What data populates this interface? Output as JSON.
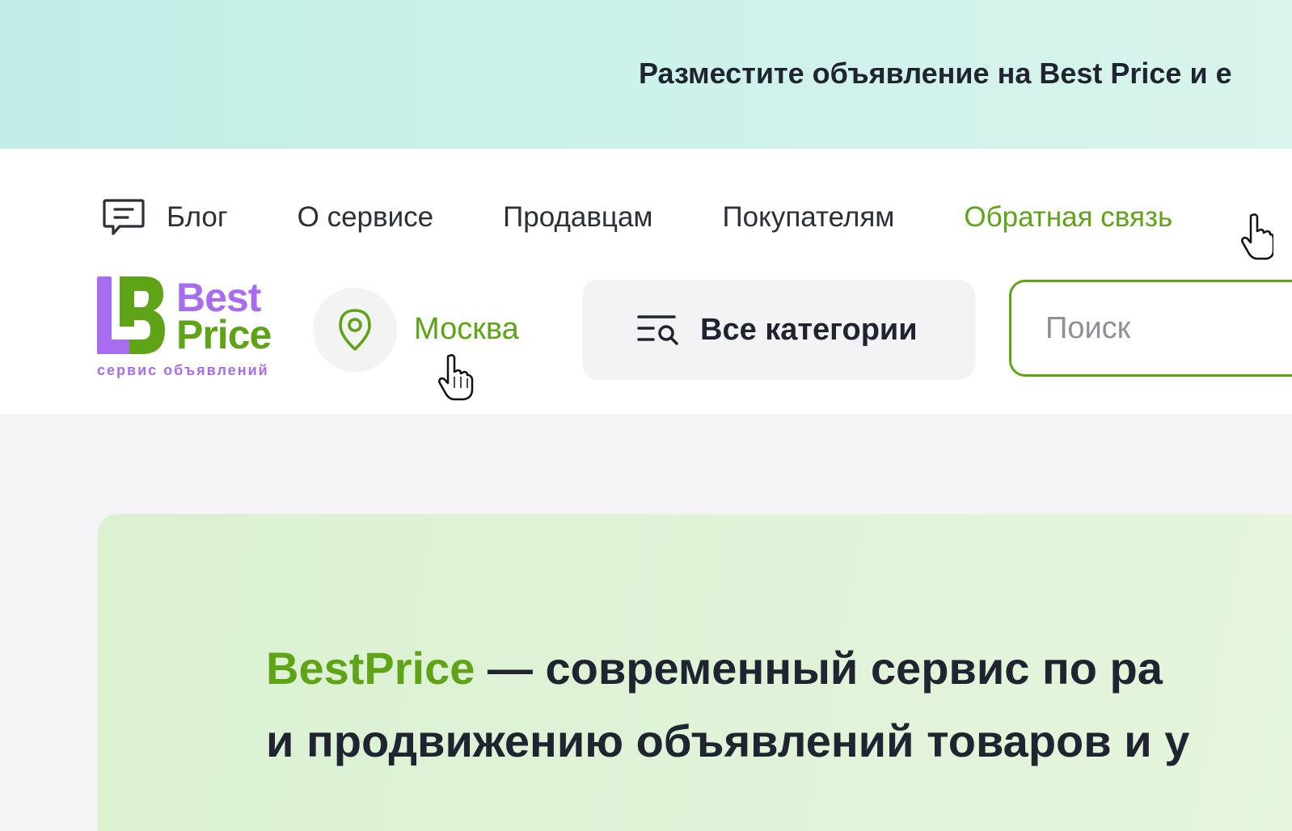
{
  "promo": {
    "text": "Разместите объявление на Best Price и е"
  },
  "nav": {
    "items": [
      {
        "label": "Блог"
      },
      {
        "label": "О сервисе"
      },
      {
        "label": "Продавцам"
      },
      {
        "label": "Покупателям"
      },
      {
        "label": "Обратная связь"
      }
    ]
  },
  "logo": {
    "word1": "Best",
    "word2": "Price",
    "tagline": "сервис объявлений"
  },
  "location": {
    "city": "Москва",
    "icon": "map-pin-icon"
  },
  "categories": {
    "label": "Все категории",
    "icon": "category-search-icon"
  },
  "search": {
    "placeholder": "Поиск",
    "value": ""
  },
  "hero": {
    "brand": "BestPrice",
    "line1_rest": " — современный сервис по ра",
    "line2": "и продвижению объявлений товаров и у"
  },
  "colors": {
    "accent_green": "#5fa317",
    "brand_purple": "#a86cf0",
    "text_dark": "#1f2430"
  }
}
